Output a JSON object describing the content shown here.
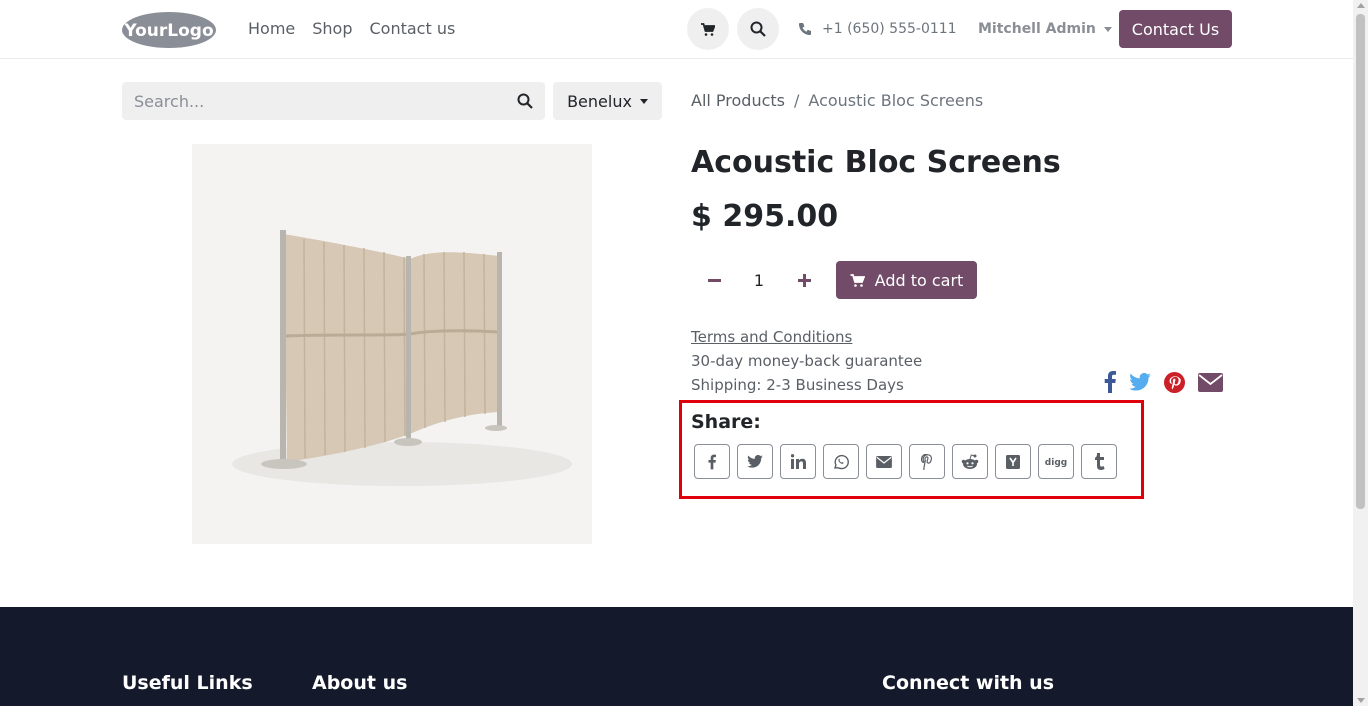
{
  "header": {
    "logo_text": "YourLogo",
    "nav": [
      "Home",
      "Shop",
      "Contact us"
    ],
    "phone": "+1 (650) 555-0111",
    "user": "Mitchell Admin",
    "cta": "Contact Us"
  },
  "search": {
    "placeholder": "Search...",
    "value": ""
  },
  "pricelist": {
    "selected": "Benelux"
  },
  "breadcrumb": {
    "parent": "All Products",
    "separator": "/",
    "current": "Acoustic Bloc Screens"
  },
  "product": {
    "name": "Acoustic Bloc Screens",
    "price": "$ 295.00",
    "quantity": "1",
    "add_to_cart": "Add to cart",
    "terms": "Terms and Conditions",
    "guarantee": "30-day money-back guarantee",
    "shipping": "Shipping: 2-3 Business Days"
  },
  "social_links": [
    "facebook-icon",
    "twitter-icon",
    "pinterest-icon",
    "envelope-icon"
  ],
  "share": {
    "label": "Share:",
    "buttons": [
      "facebook",
      "twitter",
      "linkedin",
      "whatsapp",
      "email",
      "pinterest",
      "reddit",
      "hacker-news",
      "digg",
      "tumblr"
    ]
  },
  "footer": {
    "col1": "Useful Links",
    "col2": "About us",
    "col3": "Connect with us"
  },
  "colors": {
    "primary": "#714B67",
    "footer_bg": "#141a2b",
    "highlight": "#e0000b"
  }
}
